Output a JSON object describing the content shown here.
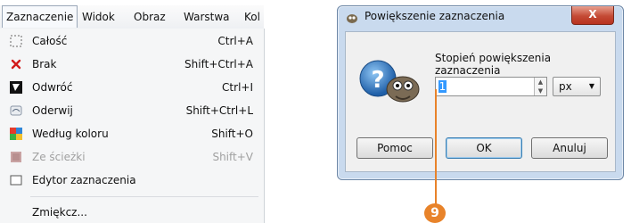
{
  "menubar": {
    "items": [
      {
        "label": "Zaznaczenie"
      },
      {
        "label": "Widok"
      },
      {
        "label": "Obraz"
      },
      {
        "label": "Warstwa"
      },
      {
        "label": "Kol"
      }
    ]
  },
  "menu": {
    "items": [
      {
        "label": "Całość",
        "shortcut": "Ctrl+A",
        "icon": "select-all-icon",
        "enabled": true
      },
      {
        "label": "Brak",
        "shortcut": "Shift+Ctrl+A",
        "icon": "red-x-icon",
        "enabled": true
      },
      {
        "label": "Odwróć",
        "shortcut": "Ctrl+I",
        "icon": "invert-icon",
        "enabled": true
      },
      {
        "label": "Oderwij",
        "shortcut": "Shift+Ctrl+L",
        "icon": "float-icon",
        "enabled": true
      },
      {
        "label": "Według koloru",
        "shortcut": "Shift+O",
        "icon": "by-color-icon",
        "enabled": true
      },
      {
        "label": "Ze ścieżki",
        "shortcut": "Shift+V",
        "icon": "from-path-icon",
        "enabled": false
      },
      {
        "label": "Edytor zaznaczenia",
        "shortcut": "",
        "icon": "selection-editor-icon",
        "enabled": true
      },
      {
        "label": "Zmiękcz...",
        "shortcut": "",
        "icon": "",
        "enabled": true
      }
    ]
  },
  "dialog": {
    "title": "Powiększenie zaznaczenia",
    "close_label": "X",
    "prompt": "Stopień powiększenia zaznaczenia",
    "value": "1",
    "unit": "px",
    "buttons": {
      "help": "Pomoc",
      "ok": "OK",
      "cancel": "Anuluj"
    }
  },
  "callout": {
    "number": "9"
  },
  "colors": {
    "callout": "#e8832a",
    "dialog_frame": "#c9daee"
  }
}
